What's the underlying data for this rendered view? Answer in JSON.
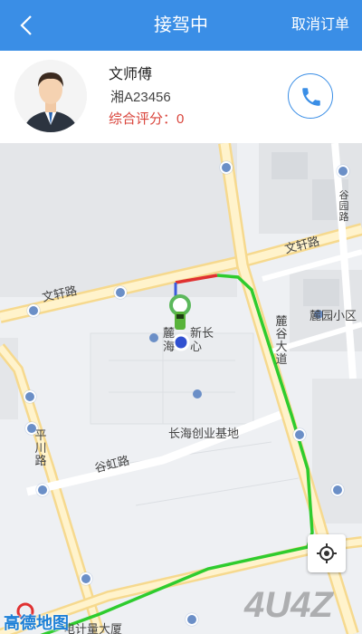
{
  "header": {
    "title": "接驾中",
    "cancel_label": "取消订单",
    "background": "#3a8ee6"
  },
  "driver": {
    "name": "文师傅",
    "plate": "湘A23456",
    "rating_label": "综合评分：",
    "rating_value": "0",
    "rating_color": "#d9443b"
  },
  "map": {
    "roads": {
      "wenxuan_1": "文轩路",
      "wenxuan_2": "文轩路",
      "guhong": "谷虹路",
      "pingchuan": "平川路",
      "lugu": "麓谷大道",
      "guyuan": "谷园路"
    },
    "pois": {
      "lugu_xinchang_a": "麓",
      "lugu_xinchang_b": "新长",
      "lugu_xinchang_c": "海",
      "lugu_xinchang_d": "心",
      "changhai": "长海创业基地",
      "luyuan": "麓园小区",
      "bottom_poi": "电计量大厦"
    },
    "logo": "高德地图",
    "watermark": "4U4Z",
    "route_colors": {
      "green": "#2ecc2e",
      "red": "#e03131",
      "blue": "#3b5bdb"
    }
  },
  "icons": {
    "back": "chevron-left-icon",
    "phone": "phone-icon",
    "locate": "locate-icon",
    "bus": "bus-stop-icon",
    "car": "car-icon"
  }
}
